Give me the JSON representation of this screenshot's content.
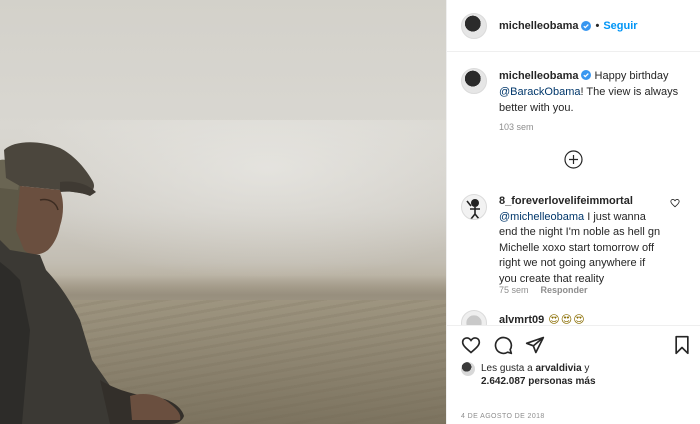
{
  "post": {
    "author": "michelleobama",
    "separator": "•",
    "follow_label": "Seguir"
  },
  "caption": {
    "username": "michelleobama",
    "text_before": "Happy birthday ",
    "mention": "@BarackObama",
    "text_after": "! The view is always better with you.",
    "time_ago": "103 sem"
  },
  "comments": [
    {
      "username": "8_foreverlovelifeimmortal",
      "mention": "@michelleobama",
      "text": " I just wanna end the night I'm noble as hell gn Michelle xoxo start tomorrow off right we not going anywhere if you create that reality",
      "time_ago": "75 sem",
      "reply_label": "Responder"
    },
    {
      "username": "alvmrt09",
      "emojis": "😍😍😍"
    }
  ],
  "likes": {
    "prefix": "Les gusta a ",
    "user": "arvaldivia",
    "connector": " y",
    "count": "2.642.087",
    "suffix": " personas más"
  },
  "date": "4 DE AGOSTO DE 2018",
  "colors": {
    "link_blue": "#0095f6",
    "mention_blue": "#00376b",
    "muted_gray": "#8e8e8e",
    "verified_blue": "#3897f0"
  },
  "icons": [
    "verified-badge-icon",
    "load-more-plus-icon",
    "heart-icon",
    "comment-icon",
    "share-icon",
    "bookmark-icon"
  ]
}
